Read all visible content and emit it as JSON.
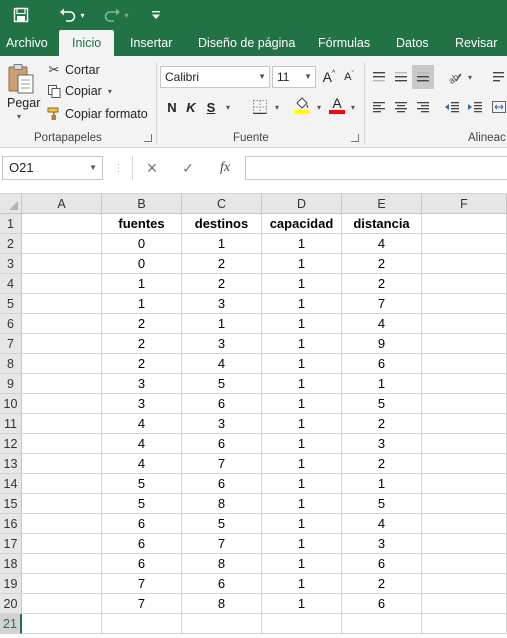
{
  "quick_access": {
    "save_icon": "save-icon",
    "undo_icon": "undo-icon",
    "redo_icon": "redo-icon",
    "customize_icon": "customize-qat-icon"
  },
  "tabs": [
    "Archivo",
    "Inicio",
    "Insertar",
    "Diseño de página",
    "Fórmulas",
    "Datos",
    "Revisar"
  ],
  "active_tab": "Inicio",
  "ribbon": {
    "portapapeles": {
      "paste_label": "Pegar",
      "cut_label": "Cortar",
      "copy_label": "Copiar",
      "format_painter_label": "Copiar formato",
      "group_label": "Portapapeles"
    },
    "fuente": {
      "font_name": "Calibri",
      "font_size": "11",
      "bold": "N",
      "italic": "K",
      "underline": "S",
      "grow_font": "A",
      "shrink_font": "A",
      "font_color": "A",
      "group_label": "Fuente"
    },
    "alineacion": {
      "group_label": "Alineac"
    },
    "colors": {
      "brand": "#217346",
      "highlight": "#ffff00",
      "font_color": "#ff0000"
    }
  },
  "formula_bar": {
    "name_box": "O21",
    "cancel_icon": "×",
    "enter_icon": "✓",
    "fx_label": "fx",
    "value": ""
  },
  "sheet": {
    "columns": [
      "A",
      "B",
      "C",
      "D",
      "E",
      "F"
    ],
    "row_numbers": [
      "1",
      "2",
      "3",
      "4",
      "5",
      "6",
      "7",
      "8",
      "9",
      "10",
      "11",
      "12",
      "13",
      "14",
      "15",
      "16",
      "17",
      "18",
      "19",
      "20",
      "21"
    ],
    "selected_row": "21",
    "headers": [
      "fuentes",
      "destinos",
      "capacidad",
      "distancia"
    ],
    "rows": [
      [
        "0",
        "1",
        "1",
        "4"
      ],
      [
        "0",
        "2",
        "1",
        "2"
      ],
      [
        "1",
        "2",
        "1",
        "2"
      ],
      [
        "1",
        "3",
        "1",
        "7"
      ],
      [
        "2",
        "1",
        "1",
        "4"
      ],
      [
        "2",
        "3",
        "1",
        "9"
      ],
      [
        "2",
        "4",
        "1",
        "6"
      ],
      [
        "3",
        "5",
        "1",
        "1"
      ],
      [
        "3",
        "6",
        "1",
        "5"
      ],
      [
        "4",
        "3",
        "1",
        "2"
      ],
      [
        "4",
        "6",
        "1",
        "3"
      ],
      [
        "4",
        "7",
        "1",
        "2"
      ],
      [
        "5",
        "6",
        "1",
        "1"
      ],
      [
        "5",
        "8",
        "1",
        "5"
      ],
      [
        "6",
        "5",
        "1",
        "4"
      ],
      [
        "6",
        "7",
        "1",
        "3"
      ],
      [
        "6",
        "8",
        "1",
        "6"
      ],
      [
        "7",
        "6",
        "1",
        "2"
      ],
      [
        "7",
        "8",
        "1",
        "6"
      ]
    ]
  }
}
